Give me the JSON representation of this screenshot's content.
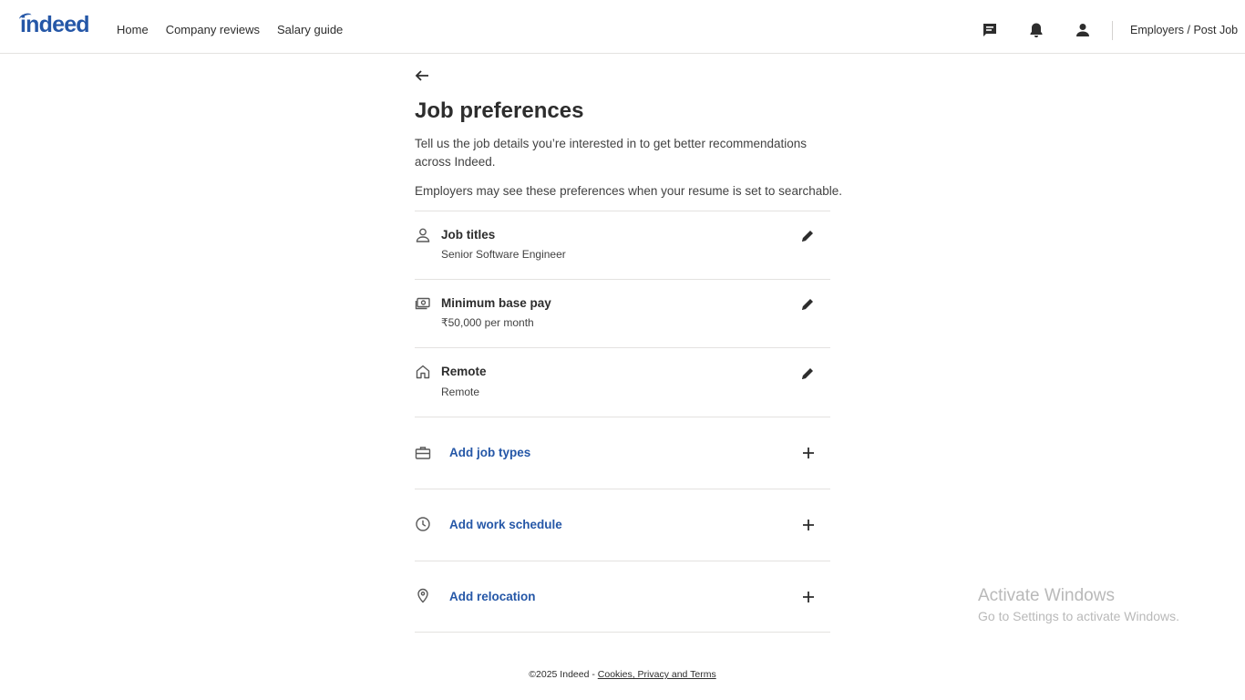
{
  "header": {
    "logo": "indeed",
    "nav": [
      "Home",
      "Company reviews",
      "Salary guide"
    ],
    "icons": [
      "messages-icon",
      "notifications-icon",
      "account-icon"
    ],
    "employers_link": "Employers / Post Job"
  },
  "page": {
    "title": "Job preferences",
    "description": "Tell us the job details you’re interested in to get better recommendations across Indeed.",
    "visibility_note": "Employers may see these preferences when your resume is set to searchable."
  },
  "preferences": [
    {
      "icon": "person-icon",
      "label": "Job titles",
      "value": "Senior Software Engineer"
    },
    {
      "icon": "money-icon",
      "label": "Minimum base pay",
      "value": "₹50,000 per month"
    },
    {
      "icon": "home-icon",
      "label": "Remote",
      "value": "Remote"
    }
  ],
  "add_items": [
    {
      "icon": "briefcase-icon",
      "label": "Add job types"
    },
    {
      "icon": "clock-icon",
      "label": "Add work schedule"
    },
    {
      "icon": "location-pin-icon",
      "label": "Add relocation"
    }
  ],
  "footer": {
    "copyright": "©2025 Indeed - ",
    "link": "Cookies, Privacy and Terms"
  },
  "watermark": {
    "line1": "Activate Windows",
    "line2": "Go to Settings to activate Windows."
  },
  "colors": {
    "brand_blue": "#2557a7",
    "text": "#2d2d2d",
    "divider": "#e4e2e0"
  }
}
